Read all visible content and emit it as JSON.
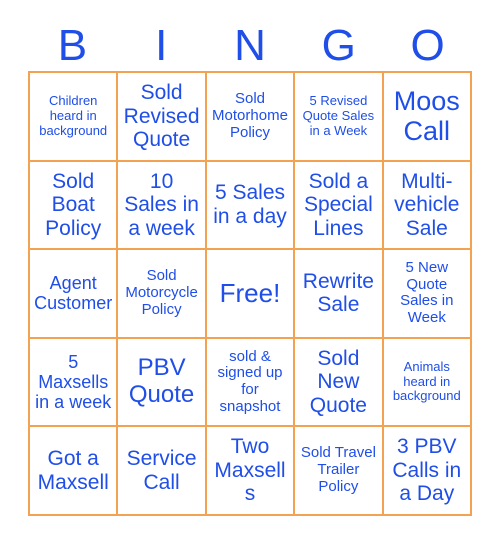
{
  "card": {
    "title": "BINGO",
    "header_letters": [
      "B",
      "I",
      "N",
      "G",
      "O"
    ],
    "colors": {
      "text": "#1f4ee8",
      "border": "#f2a250",
      "background": "#ffffff"
    },
    "rows": [
      [
        {
          "label": "Children heard in background",
          "size": "xs"
        },
        {
          "label": "Sold Revised Quote",
          "size": "lg"
        },
        {
          "label": "Sold Motorhome Policy",
          "size": "sm"
        },
        {
          "label": "5 Revised Quote Sales in a Week",
          "size": "xs"
        },
        {
          "label": "Moos Call",
          "size": "xxl"
        }
      ],
      [
        {
          "label": "Sold Boat Policy",
          "size": "lg"
        },
        {
          "label": "10 Sales in a week",
          "size": "lg"
        },
        {
          "label": "5 Sales in a day",
          "size": "lg"
        },
        {
          "label": "Sold a Special Lines",
          "size": "lg"
        },
        {
          "label": "Multi-vehicle Sale",
          "size": "lg"
        }
      ],
      [
        {
          "label": "Agent Customer",
          "size": "md"
        },
        {
          "label": "Sold Motorcycle Policy",
          "size": "sm"
        },
        {
          "label": "Free!",
          "size": "free"
        },
        {
          "label": "Rewrite Sale",
          "size": "lg"
        },
        {
          "label": "5 New Quote Sales in Week",
          "size": "sm"
        }
      ],
      [
        {
          "label": "5 Maxsells in a week",
          "size": "md"
        },
        {
          "label": "PBV Quote",
          "size": "xl"
        },
        {
          "label": "sold & signed up for snapshot",
          "size": "sm"
        },
        {
          "label": "Sold New Quote",
          "size": "lg"
        },
        {
          "label": "Animals heard in background",
          "size": "xs"
        }
      ],
      [
        {
          "label": "Got a Maxsell",
          "size": "lg"
        },
        {
          "label": "Service Call",
          "size": "lg"
        },
        {
          "label": "Two Maxsells",
          "size": "lg"
        },
        {
          "label": "Sold Travel Trailer Policy",
          "size": "sm"
        },
        {
          "label": "3 PBV Calls in a Day",
          "size": "lg"
        }
      ]
    ]
  }
}
